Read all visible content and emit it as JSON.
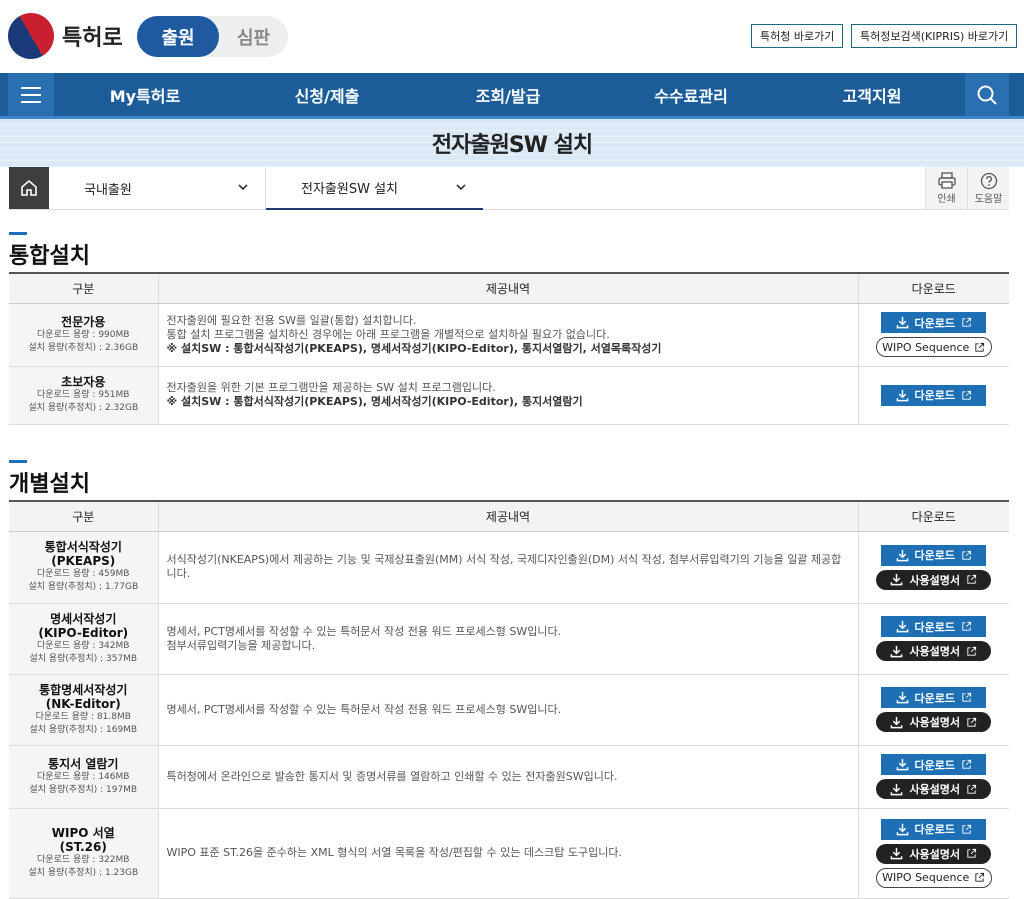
{
  "header": {
    "logo_text": "특허로",
    "mode_active": "출원",
    "mode_inactive": "심판",
    "links": [
      "특허청 바로가기",
      "특허정보검색(KIPRIS) 바로가기"
    ]
  },
  "gnb": {
    "items": [
      "My특허로",
      "신청/제출",
      "조회/발급",
      "수수료관리",
      "고객지원"
    ]
  },
  "page": {
    "title": "전자출원SW 설치"
  },
  "breadcrumb": {
    "level1": "국내출원",
    "level2": "전자출원SW 설치",
    "print_label": "인쇄",
    "help_label": "도움말"
  },
  "sections": {
    "integrated_title": "통합설치",
    "individual_title": "개별설치"
  },
  "table_headers": {
    "category": "구분",
    "details": "제공내역",
    "download": "다운로드"
  },
  "buttons": {
    "download": "다운로드",
    "manual": "사용설명서",
    "wipo": "WIPO Sequence"
  },
  "integrated_rows": [
    {
      "name": "전문가용",
      "dl_size": "다운로드 용량 : 990MB",
      "install_size": "설치 용량(추정치) : 2.36GB",
      "desc1": "전자출원에 필요한 전용 SW를 일괄(통합) 설치합니다.",
      "desc2": "통합 설치 프로그램을 설치하신 경우에는 아래 프로그램을 개별적으로 설치하실 필요가 없습니다.",
      "desc3": "※ 설치SW : 통합서식작성기(PKEAPS), 명세서작성기(KIPO-Editor), 통지서열람기, 서열목록작성기"
    },
    {
      "name": "초보자용",
      "dl_size": "다운로드 용량 : 951MB",
      "install_size": "설치 용량(추정치) : 2.32GB",
      "desc1": "전자출원을 위한 기본 프로그램만을 제공하는 SW 설치 프로그램입니다.",
      "desc2": "※ 설치SW : 통합서식작성기(PKEAPS), 명세서작성기(KIPO-Editor), 통지서열람기"
    }
  ],
  "individual_rows": [
    {
      "name1": "통합서식작성기",
      "name2": "(PKEAPS)",
      "dl_size": "다운로드 용량 : 459MB",
      "install_size": "설치 용량(추정치) : 1.77GB",
      "desc1": "서식작성기(NKEAPS)에서 제공하는 기능 및 국제상표출원(MM) 서식 작성, 국제디자인출원(DM) 서식 작성, 첨부서류입력기의 기능을 일괄 제공합니다."
    },
    {
      "name1": "명세서작성기",
      "name2": "(KIPO-Editor)",
      "dl_size": "다운로드 용량 : 342MB",
      "install_size": "설치 용량(추정치) : 357MB",
      "desc1": "명세서, PCT명세서를 작성할 수 있는 특허문서 작성 전용 워드 프로세스형 SW입니다.",
      "desc2": "첨부서류입력기능을 제공합니다."
    },
    {
      "name1": "통합명세서작성기",
      "name2": "(NK-Editor)",
      "dl_size": "다운로드 용량 : 81.8MB",
      "install_size": "설치 용량(추정치) : 169MB",
      "desc1": "명세서, PCT명세서를 작성할 수 있는 특허문서 작성 전용 워드 프로세스형 SW입니다."
    },
    {
      "name1": "통지서 열람기",
      "dl_size": "다운로드 용량 : 146MB",
      "install_size": "설치 용량(추정치) : 197MB",
      "desc1": "특허청에서 온라인으로 발송한 통지서 및 증명서류를 열람하고 인쇄할 수 있는 전자출원SW입니다."
    },
    {
      "name1": "WIPO 서열",
      "name2": "(ST.26)",
      "dl_size": "다운로드 용량 : 322MB",
      "install_size": "설치 용량(추정치) : 1.23GB",
      "desc1": "WIPO 표준 ST.26을 준수하는 XML 형식의 서열 목록을 작성/편집할 수 있는 데스크탑 도구입니다."
    }
  ]
}
